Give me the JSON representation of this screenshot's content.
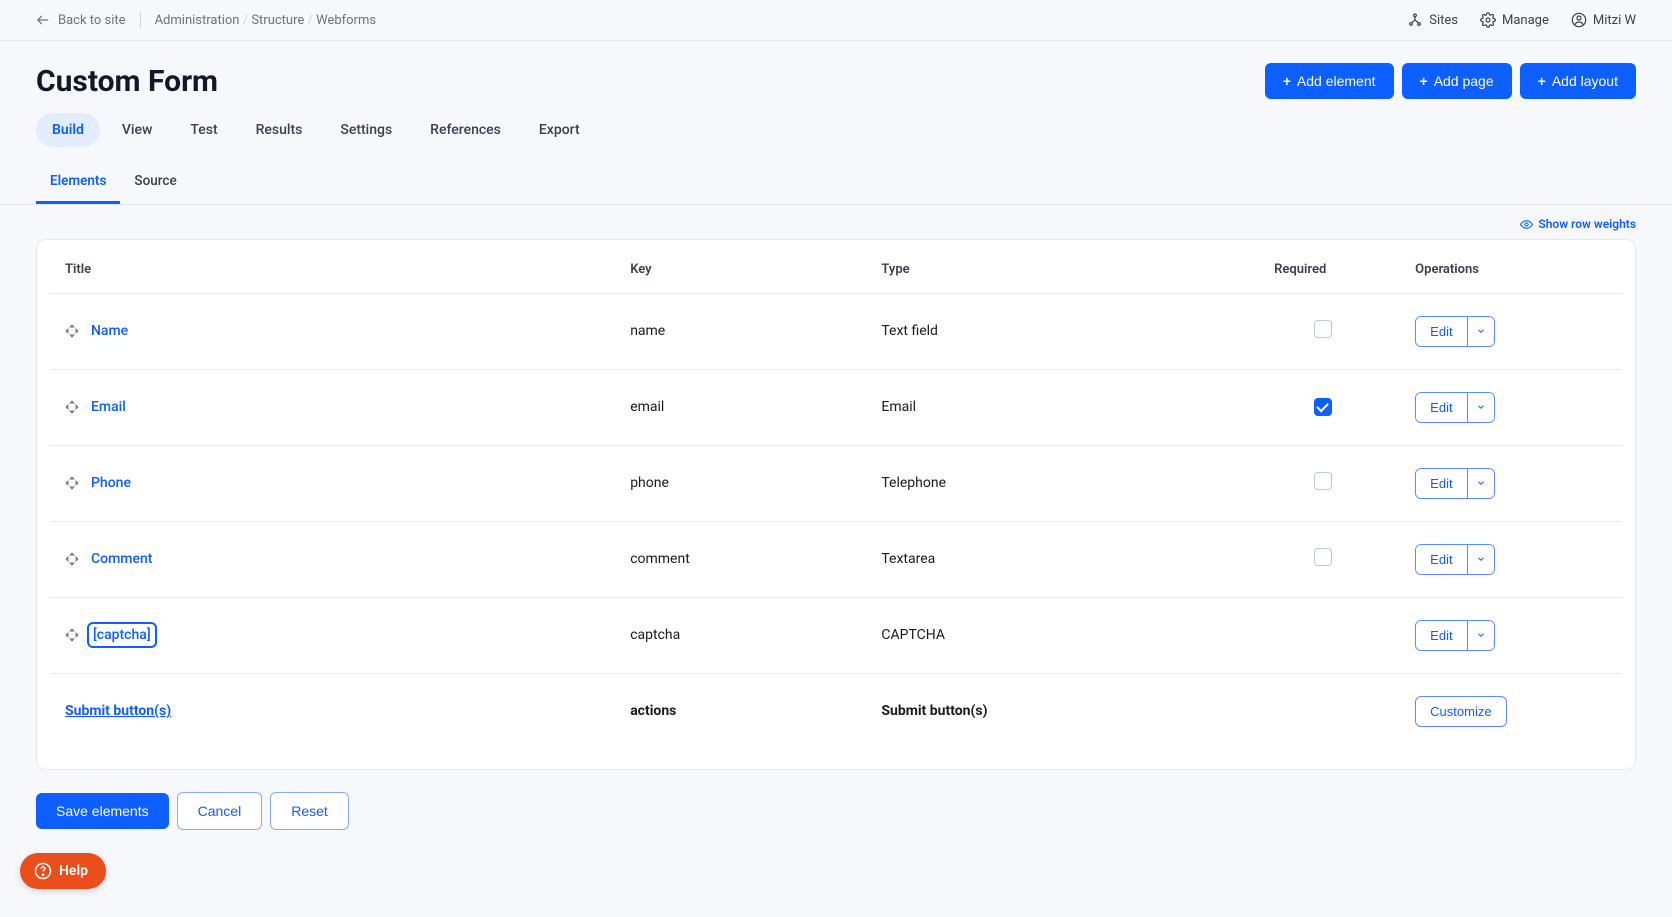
{
  "topbar": {
    "back_label": "Back to site",
    "breadcrumbs": [
      "Administration",
      "Structure",
      "Webforms"
    ],
    "sites_label": "Sites",
    "manage_label": "Manage",
    "user_name": "Mitzi W"
  },
  "header": {
    "title": "Custom Form",
    "add_element": "Add element",
    "add_page": "Add page",
    "add_layout": "Add layout"
  },
  "tabs_primary": [
    "Build",
    "View",
    "Test",
    "Results",
    "Settings",
    "References",
    "Export"
  ],
  "tabs_primary_active": 0,
  "tabs_secondary": [
    "Elements",
    "Source"
  ],
  "tabs_secondary_active": 0,
  "row_weights_label": "Show row weights",
  "table": {
    "headers": {
      "title": "Title",
      "key": "Key",
      "type": "Type",
      "required": "Required",
      "operations": "Operations"
    },
    "edit_label": "Edit",
    "customize_label": "Customize",
    "rows": [
      {
        "title": "Name",
        "key": "name",
        "type": "Text field",
        "required": false,
        "draggable": true,
        "focused": false
      },
      {
        "title": "Email",
        "key": "email",
        "type": "Email",
        "required": true,
        "draggable": true,
        "focused": false
      },
      {
        "title": "Phone",
        "key": "phone",
        "type": "Telephone",
        "required": false,
        "draggable": true,
        "focused": false
      },
      {
        "title": "Comment",
        "key": "comment",
        "type": "Textarea",
        "required": false,
        "draggable": true,
        "focused": false
      },
      {
        "title": "[captcha]",
        "key": "captcha",
        "type": "CAPTCHA",
        "required": null,
        "draggable": true,
        "focused": true
      }
    ],
    "submit_row": {
      "title": "Submit button(s)",
      "key": "actions",
      "type": "Submit button(s)"
    }
  },
  "footer": {
    "save_label": "Save elements",
    "cancel_label": "Cancel",
    "reset_label": "Reset"
  },
  "help": {
    "label": "Help"
  }
}
